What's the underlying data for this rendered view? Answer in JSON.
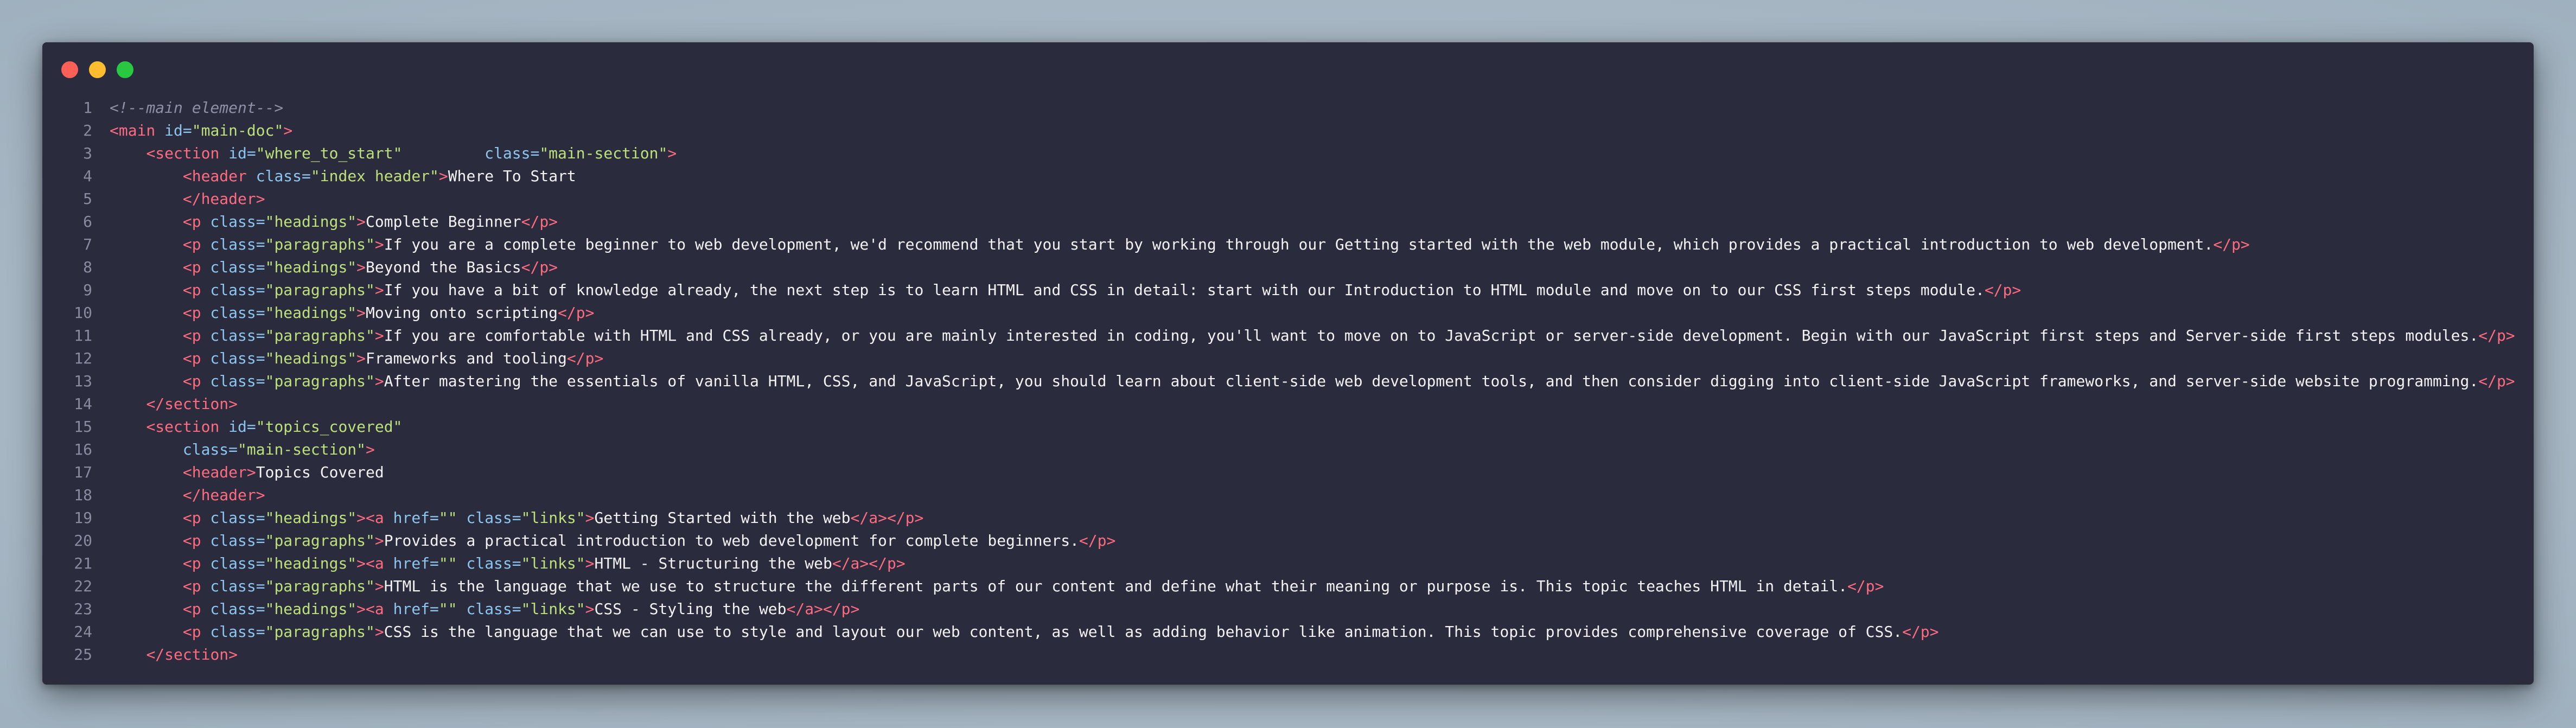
{
  "window": {
    "controls": [
      "close",
      "minimize",
      "zoom"
    ],
    "colors": {
      "close": "#fe5f57",
      "minimize": "#febc2e",
      "zoom": "#28c840",
      "background": "#2b2b3e"
    }
  },
  "code": {
    "language": "html",
    "lines": [
      {
        "n": "1",
        "tokens": [
          {
            "k": "c",
            "v": "<!--main element-->"
          }
        ]
      },
      {
        "n": "2",
        "tokens": [
          {
            "k": "t",
            "v": "<main"
          },
          {
            "k": "a",
            "v": " id="
          },
          {
            "k": "s",
            "v": "\"main-doc\""
          },
          {
            "k": "t",
            "v": ">"
          }
        ]
      },
      {
        "n": "3",
        "tokens": [
          {
            "k": "x",
            "v": "    "
          },
          {
            "k": "t",
            "v": "<section"
          },
          {
            "k": "a",
            "v": " id="
          },
          {
            "k": "s",
            "v": "\"where_to_start\""
          },
          {
            "k": "x",
            "v": "         "
          },
          {
            "k": "a",
            "v": "class="
          },
          {
            "k": "s",
            "v": "\"main-section\""
          },
          {
            "k": "t",
            "v": ">"
          }
        ]
      },
      {
        "n": "4",
        "tokens": [
          {
            "k": "x",
            "v": "        "
          },
          {
            "k": "t",
            "v": "<header"
          },
          {
            "k": "a",
            "v": " class="
          },
          {
            "k": "s",
            "v": "\"index header\""
          },
          {
            "k": "t",
            "v": ">"
          },
          {
            "k": "x",
            "v": "Where To Start"
          }
        ]
      },
      {
        "n": "5",
        "tokens": [
          {
            "k": "x",
            "v": "        "
          },
          {
            "k": "t",
            "v": "</header>"
          }
        ]
      },
      {
        "n": "6",
        "tokens": [
          {
            "k": "x",
            "v": "        "
          },
          {
            "k": "t",
            "v": "<p"
          },
          {
            "k": "a",
            "v": " class="
          },
          {
            "k": "s",
            "v": "\"headings\""
          },
          {
            "k": "t",
            "v": ">"
          },
          {
            "k": "x",
            "v": "Complete Beginner"
          },
          {
            "k": "t",
            "v": "</p>"
          }
        ]
      },
      {
        "n": "7",
        "tokens": [
          {
            "k": "x",
            "v": "        "
          },
          {
            "k": "t",
            "v": "<p"
          },
          {
            "k": "a",
            "v": " class="
          },
          {
            "k": "s",
            "v": "\"paragraphs\""
          },
          {
            "k": "t",
            "v": ">"
          },
          {
            "k": "x",
            "v": "If you are a complete beginner to web development, we'd recommend that you start by working through our Getting started with the web module, which provides a practical introduction to web development."
          },
          {
            "k": "t",
            "v": "</p>"
          }
        ]
      },
      {
        "n": "8",
        "tokens": [
          {
            "k": "x",
            "v": "        "
          },
          {
            "k": "t",
            "v": "<p"
          },
          {
            "k": "a",
            "v": " class="
          },
          {
            "k": "s",
            "v": "\"headings\""
          },
          {
            "k": "t",
            "v": ">"
          },
          {
            "k": "x",
            "v": "Beyond the Basics"
          },
          {
            "k": "t",
            "v": "</p>"
          }
        ]
      },
      {
        "n": "9",
        "tokens": [
          {
            "k": "x",
            "v": "        "
          },
          {
            "k": "t",
            "v": "<p"
          },
          {
            "k": "a",
            "v": " class="
          },
          {
            "k": "s",
            "v": "\"paragraphs\""
          },
          {
            "k": "t",
            "v": ">"
          },
          {
            "k": "x",
            "v": "If you have a bit of knowledge already, the next step is to learn HTML and CSS in detail: start with our Introduction to HTML module and move on to our CSS first steps module."
          },
          {
            "k": "t",
            "v": "</p>"
          }
        ]
      },
      {
        "n": "10",
        "tokens": [
          {
            "k": "x",
            "v": "        "
          },
          {
            "k": "t",
            "v": "<p"
          },
          {
            "k": "a",
            "v": " class="
          },
          {
            "k": "s",
            "v": "\"headings\""
          },
          {
            "k": "t",
            "v": ">"
          },
          {
            "k": "x",
            "v": "Moving onto scripting"
          },
          {
            "k": "t",
            "v": "</p>"
          }
        ]
      },
      {
        "n": "11",
        "tokens": [
          {
            "k": "x",
            "v": "        "
          },
          {
            "k": "t",
            "v": "<p"
          },
          {
            "k": "a",
            "v": " class="
          },
          {
            "k": "s",
            "v": "\"paragraphs\""
          },
          {
            "k": "t",
            "v": ">"
          },
          {
            "k": "x",
            "v": "If you are comfortable with HTML and CSS already, or you are mainly interested in coding, you'll want to move on to JavaScript or server-side development. Begin with our JavaScript first steps and Server-side first steps modules."
          },
          {
            "k": "t",
            "v": "</p>"
          }
        ]
      },
      {
        "n": "12",
        "tokens": [
          {
            "k": "x",
            "v": "        "
          },
          {
            "k": "t",
            "v": "<p"
          },
          {
            "k": "a",
            "v": " class="
          },
          {
            "k": "s",
            "v": "\"headings\""
          },
          {
            "k": "t",
            "v": ">"
          },
          {
            "k": "x",
            "v": "Frameworks and tooling"
          },
          {
            "k": "t",
            "v": "</p>"
          }
        ]
      },
      {
        "n": "13",
        "tokens": [
          {
            "k": "x",
            "v": "        "
          },
          {
            "k": "t",
            "v": "<p"
          },
          {
            "k": "a",
            "v": " class="
          },
          {
            "k": "s",
            "v": "\"paragraphs\""
          },
          {
            "k": "t",
            "v": ">"
          },
          {
            "k": "x",
            "v": "After mastering the essentials of vanilla HTML, CSS, and JavaScript, you should learn about client-side web development tools, and then consider digging into client-side JavaScript frameworks, and server-side website programming."
          },
          {
            "k": "t",
            "v": "</p>"
          }
        ]
      },
      {
        "n": "14",
        "tokens": [
          {
            "k": "x",
            "v": "    "
          },
          {
            "k": "t",
            "v": "</section>"
          }
        ]
      },
      {
        "n": "15",
        "tokens": [
          {
            "k": "x",
            "v": "    "
          },
          {
            "k": "t",
            "v": "<section"
          },
          {
            "k": "a",
            "v": " id="
          },
          {
            "k": "s",
            "v": "\"topics_covered\""
          }
        ]
      },
      {
        "n": "16",
        "tokens": [
          {
            "k": "x",
            "v": "        "
          },
          {
            "k": "a",
            "v": "class="
          },
          {
            "k": "s",
            "v": "\"main-section\""
          },
          {
            "k": "t",
            "v": ">"
          }
        ]
      },
      {
        "n": "17",
        "tokens": [
          {
            "k": "x",
            "v": "        "
          },
          {
            "k": "t",
            "v": "<header>"
          },
          {
            "k": "x",
            "v": "Topics Covered"
          }
        ]
      },
      {
        "n": "18",
        "tokens": [
          {
            "k": "x",
            "v": "        "
          },
          {
            "k": "t",
            "v": "</header>"
          }
        ]
      },
      {
        "n": "19",
        "tokens": [
          {
            "k": "x",
            "v": "        "
          },
          {
            "k": "t",
            "v": "<p"
          },
          {
            "k": "a",
            "v": " class="
          },
          {
            "k": "s",
            "v": "\"headings\""
          },
          {
            "k": "t",
            "v": "><a"
          },
          {
            "k": "a",
            "v": " href="
          },
          {
            "k": "s",
            "v": "\"\""
          },
          {
            "k": "a",
            "v": " class="
          },
          {
            "k": "s",
            "v": "\"links\""
          },
          {
            "k": "t",
            "v": ">"
          },
          {
            "k": "x",
            "v": "Getting Started with the web"
          },
          {
            "k": "t",
            "v": "</a></p>"
          }
        ]
      },
      {
        "n": "20",
        "tokens": [
          {
            "k": "x",
            "v": "        "
          },
          {
            "k": "t",
            "v": "<p"
          },
          {
            "k": "a",
            "v": " class="
          },
          {
            "k": "s",
            "v": "\"paragraphs\""
          },
          {
            "k": "t",
            "v": ">"
          },
          {
            "k": "x",
            "v": "Provides a practical introduction to web development for complete beginners."
          },
          {
            "k": "t",
            "v": "</p>"
          }
        ]
      },
      {
        "n": "21",
        "tokens": [
          {
            "k": "x",
            "v": "        "
          },
          {
            "k": "t",
            "v": "<p"
          },
          {
            "k": "a",
            "v": " class="
          },
          {
            "k": "s",
            "v": "\"headings\""
          },
          {
            "k": "t",
            "v": "><a"
          },
          {
            "k": "a",
            "v": " href="
          },
          {
            "k": "s",
            "v": "\"\""
          },
          {
            "k": "a",
            "v": " class="
          },
          {
            "k": "s",
            "v": "\"links\""
          },
          {
            "k": "t",
            "v": ">"
          },
          {
            "k": "x",
            "v": "HTML - Structuring the web"
          },
          {
            "k": "t",
            "v": "</a></p>"
          }
        ]
      },
      {
        "n": "22",
        "tokens": [
          {
            "k": "x",
            "v": "        "
          },
          {
            "k": "t",
            "v": "<p"
          },
          {
            "k": "a",
            "v": " class="
          },
          {
            "k": "s",
            "v": "\"paragraphs\""
          },
          {
            "k": "t",
            "v": ">"
          },
          {
            "k": "x",
            "v": "HTML is the language that we use to structure the different parts of our content and define what their meaning or purpose is. This topic teaches HTML in detail."
          },
          {
            "k": "t",
            "v": "</p>"
          }
        ]
      },
      {
        "n": "23",
        "tokens": [
          {
            "k": "x",
            "v": "        "
          },
          {
            "k": "t",
            "v": "<p"
          },
          {
            "k": "a",
            "v": " class="
          },
          {
            "k": "s",
            "v": "\"headings\""
          },
          {
            "k": "t",
            "v": "><a"
          },
          {
            "k": "a",
            "v": " href="
          },
          {
            "k": "s",
            "v": "\"\""
          },
          {
            "k": "a",
            "v": " class="
          },
          {
            "k": "s",
            "v": "\"links\""
          },
          {
            "k": "t",
            "v": ">"
          },
          {
            "k": "x",
            "v": "CSS - Styling the web"
          },
          {
            "k": "t",
            "v": "</a></p>"
          }
        ]
      },
      {
        "n": "24",
        "tokens": [
          {
            "k": "x",
            "v": "        "
          },
          {
            "k": "t",
            "v": "<p"
          },
          {
            "k": "a",
            "v": " class="
          },
          {
            "k": "s",
            "v": "\"paragraphs\""
          },
          {
            "k": "t",
            "v": ">"
          },
          {
            "k": "x",
            "v": "CSS is the language that we can use to style and layout our web content, as well as adding behavior like animation. This topic provides comprehensive coverage of CSS."
          },
          {
            "k": "t",
            "v": "</p>"
          }
        ]
      },
      {
        "n": "25",
        "tokens": [
          {
            "k": "x",
            "v": "    "
          },
          {
            "k": "t",
            "v": "</section>"
          }
        ]
      }
    ]
  }
}
